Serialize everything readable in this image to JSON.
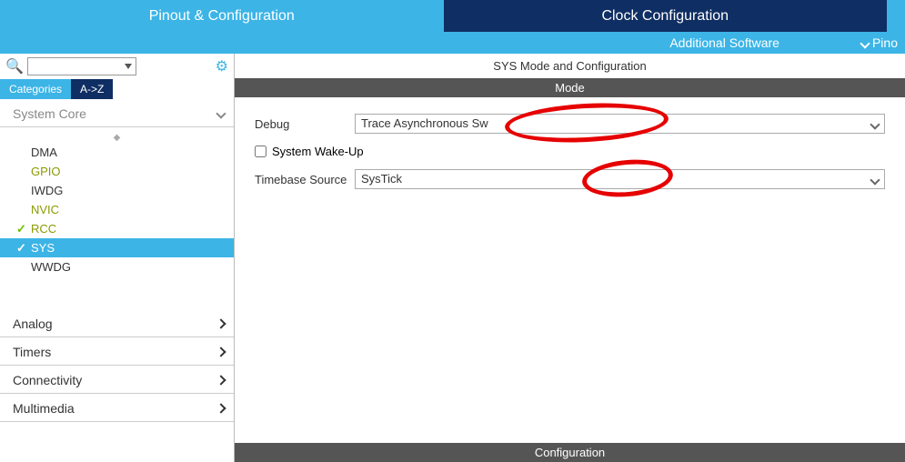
{
  "tabs": {
    "pinout": "Pinout & Configuration",
    "clock": "Clock Configuration"
  },
  "subbar": {
    "additional": "Additional Software",
    "pinout_view": "Pino"
  },
  "viewtabs": {
    "categories": "Categories",
    "az": "A->Z"
  },
  "sections": {
    "system_core": "System Core",
    "analog": "Analog",
    "timers": "Timers",
    "connectivity": "Connectivity",
    "multimedia": "Multimedia"
  },
  "system_core_items": [
    "DMA",
    "GPIO",
    "IWDG",
    "NVIC",
    "RCC",
    "SYS",
    "WWDG"
  ],
  "right": {
    "title": "SYS Mode and Configuration",
    "mode_header": "Mode",
    "cfg_header": "Configuration",
    "debug_label": "Debug",
    "debug_value": "Trace Asynchronous Sw",
    "wakeup_label": "System Wake-Up",
    "timebase_label": "Timebase Source",
    "timebase_value": "SysTick"
  }
}
